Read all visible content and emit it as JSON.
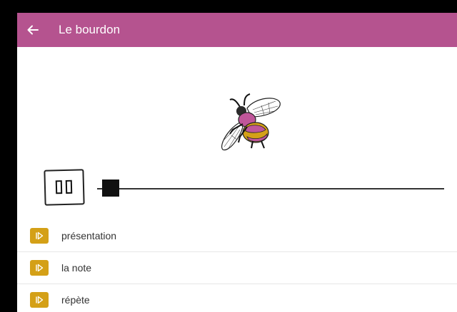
{
  "app": {
    "title": "Le bourdon",
    "accent_color": "#b5538f",
    "back_icon": "arrow-left-icon"
  },
  "illustration": {
    "icon": "bumblebee-icon"
  },
  "player": {
    "button_icon": "pause-icon",
    "state": "playing",
    "progress": 0.04
  },
  "tracks": [
    {
      "label": "présentation",
      "icon": "play-icon"
    },
    {
      "label": "la note",
      "icon": "play-icon"
    },
    {
      "label": "répète",
      "icon": "play-icon"
    }
  ],
  "colors": {
    "track_icon_bg": "#d4a017",
    "bee_pink": "#c0569a",
    "bee_gold": "#d4a017"
  }
}
